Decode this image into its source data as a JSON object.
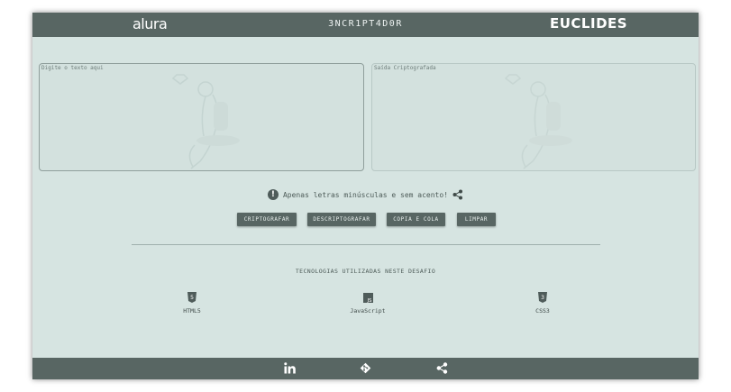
{
  "header": {
    "left_brand": "alura",
    "title": "3NCR1PT4D0R",
    "right_brand": "EUCLIDES"
  },
  "input_panel": {
    "placeholder": "Digite o texto aqui"
  },
  "output_panel": {
    "placeholder": "Saída Criptografada"
  },
  "notice": {
    "icon": "info-icon",
    "text": "Apenas letras minúsculas e sem acento!",
    "share_icon": "share-icon"
  },
  "buttons": {
    "encrypt": "CRIPTOGRAFAR",
    "decrypt": "DESCRIPTOGRAFAR",
    "copy": "COPIA E COLA",
    "clear": "LIMPAR"
  },
  "technologies": {
    "title": "TECNOLOGIAS UTILIZADAS NESTE DESAFIO",
    "items": [
      {
        "label": "HTML5",
        "icon": "html5-icon"
      },
      {
        "label": "JavaScript",
        "icon": "js-icon"
      },
      {
        "label": "CSS3",
        "icon": "css3-icon"
      }
    ]
  },
  "footer": {
    "icons": [
      "linkedin-icon",
      "git-icon",
      "share-icon"
    ]
  },
  "colors": {
    "header": "#586663",
    "background": "#d6e4e1",
    "button": "#586663"
  }
}
